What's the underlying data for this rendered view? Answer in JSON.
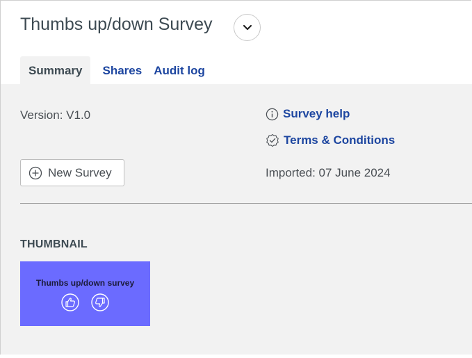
{
  "header": {
    "title": "Thumbs up/down Survey",
    "expand_icon": "chevron-down-icon"
  },
  "tabs": [
    {
      "label": "Summary",
      "active": true
    },
    {
      "label": "Shares",
      "active": false
    },
    {
      "label": "Audit log",
      "active": false
    }
  ],
  "summary": {
    "version": "Version: V1.0",
    "new_survey_label": "New Survey",
    "new_survey_icon": "plus-circle-icon",
    "help_label": "Survey help",
    "help_icon": "info-icon",
    "terms_label": "Terms & Conditions",
    "terms_icon": "check-badge-icon",
    "imported": "Imported: 07 June 2024"
  },
  "thumbnail": {
    "heading": "THUMBNAIL",
    "title": "Thumbs up/down survey",
    "background": "#6b6bff",
    "icons": [
      "thumbs-up-icon",
      "thumbs-down-icon"
    ]
  },
  "colors": {
    "link": "#1d46a0",
    "panel_bg": "#f2f2f2",
    "text": "#4a4f54"
  }
}
